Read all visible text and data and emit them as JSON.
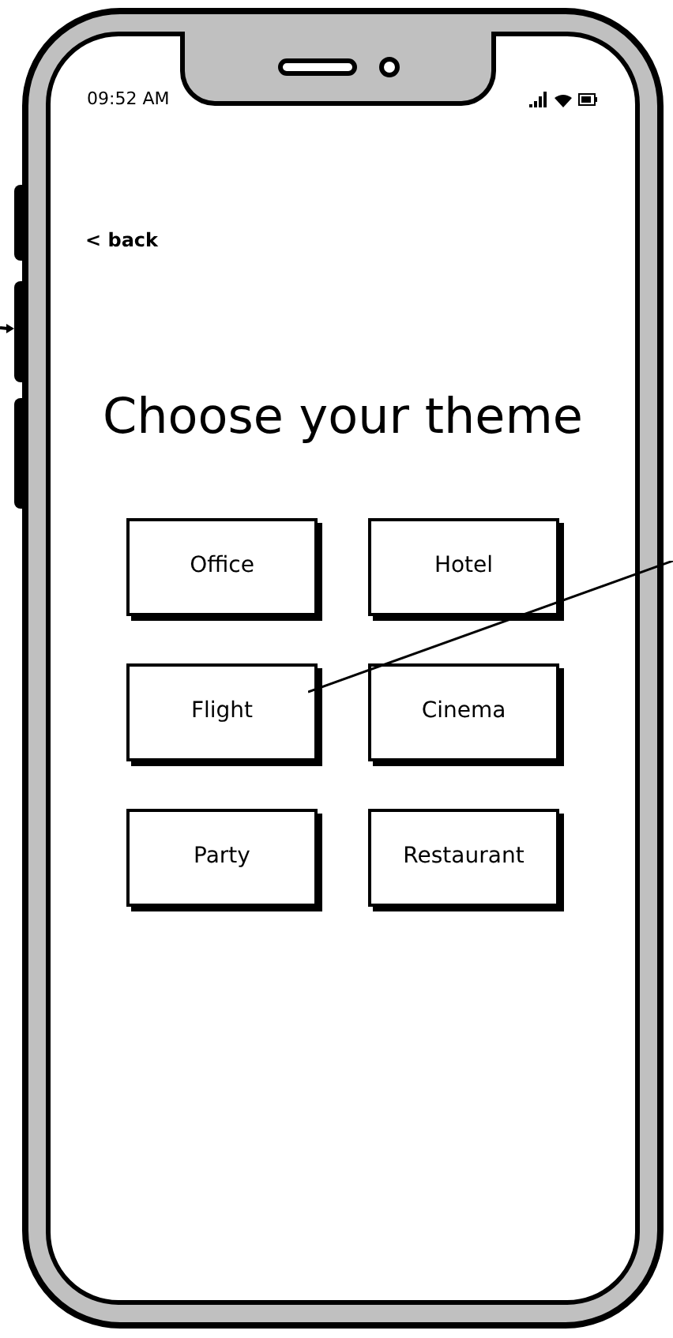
{
  "status_bar": {
    "time": "09:52 AM"
  },
  "back_link": {
    "label": "< back"
  },
  "title": "Choose your theme",
  "themes": [
    {
      "label": "Office"
    },
    {
      "label": "Hotel"
    },
    {
      "label": "Flight"
    },
    {
      "label": "Cinema"
    },
    {
      "label": "Party"
    },
    {
      "label": "Restaurant"
    }
  ]
}
